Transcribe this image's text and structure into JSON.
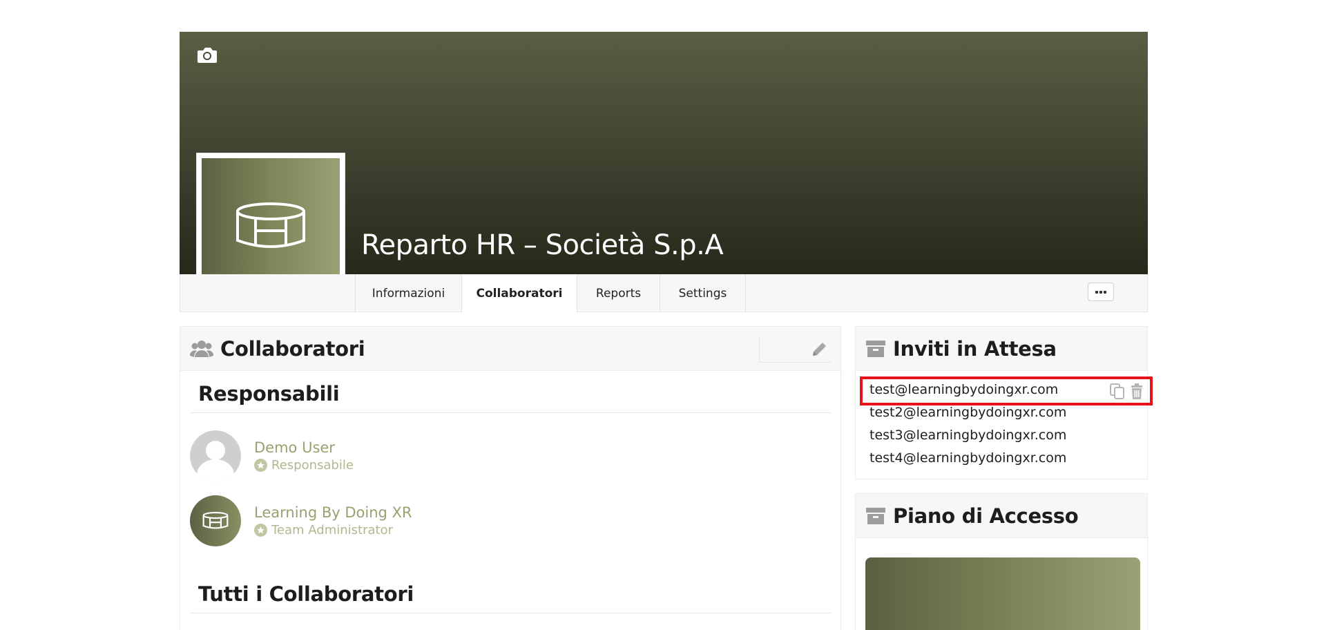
{
  "team": {
    "title": "Reparto HR – Società S.p.A"
  },
  "tabs": [
    {
      "label": "Informazioni",
      "active": false
    },
    {
      "label": "Collaboratori",
      "active": true
    },
    {
      "label": "Reports",
      "active": false
    },
    {
      "label": "Settings",
      "active": false
    }
  ],
  "collaboratori_panel": {
    "title": "Collaboratori",
    "responsabili_title": "Responsabili",
    "members": [
      {
        "name": "Demo User",
        "role": "Responsabile"
      },
      {
        "name": "Learning By Doing XR",
        "role": "Team Administrator"
      }
    ],
    "tutti_title": "Tutti i Collaboratori"
  },
  "inviti_panel": {
    "title": "Inviti in Attesa",
    "invites": [
      "test@learningbydoingxr.com",
      "test2@learningbydoingxr.com",
      "test3@learningbydoingxr.com",
      "test4@learningbydoingxr.com"
    ]
  },
  "piano_panel": {
    "title": "Piano di Accesso"
  },
  "colors": {
    "accent_olive": "#7f8558",
    "member_link": "#9aa06f",
    "highlight_red": "#e5131a"
  },
  "icons": [
    "camera-icon",
    "team-logo-icon",
    "more-icon",
    "users-icon",
    "pencil-icon",
    "archive-icon",
    "copy-icon",
    "trash-icon",
    "star-icon",
    "default-avatar-icon"
  ]
}
